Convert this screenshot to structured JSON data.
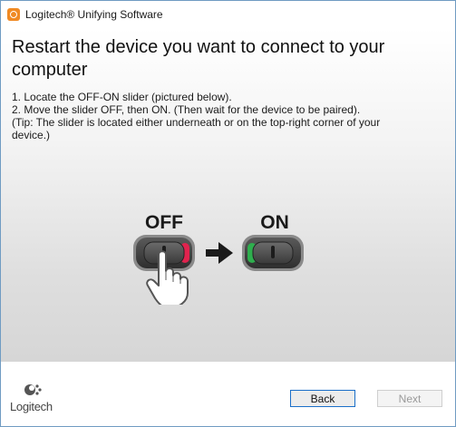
{
  "window": {
    "title": "Logitech® Unifying Software",
    "icon": "logitech-unifying-icon"
  },
  "main": {
    "heading": "Restart the device you want to connect to your computer",
    "instructions": [
      "1. Locate the OFF-ON slider (pictured below).",
      "2. Move the slider OFF, then ON. (Then wait for the device to be paired).",
      "(Tip: The slider is located either underneath or on the top-right corner of your",
      "device.)"
    ],
    "illustration": {
      "off_label": "OFF",
      "on_label": "ON",
      "off_color": "#e0234e",
      "on_color": "#2fae4e",
      "arrow_icon": "arrow-right-icon",
      "hand_icon": "pointing-hand-icon"
    }
  },
  "footer": {
    "logo_text": "Logitech",
    "back_label": "Back",
    "next_label": "Next"
  },
  "colors": {
    "title_icon": "#f08a24",
    "focus_border": "#1a6fc9"
  }
}
